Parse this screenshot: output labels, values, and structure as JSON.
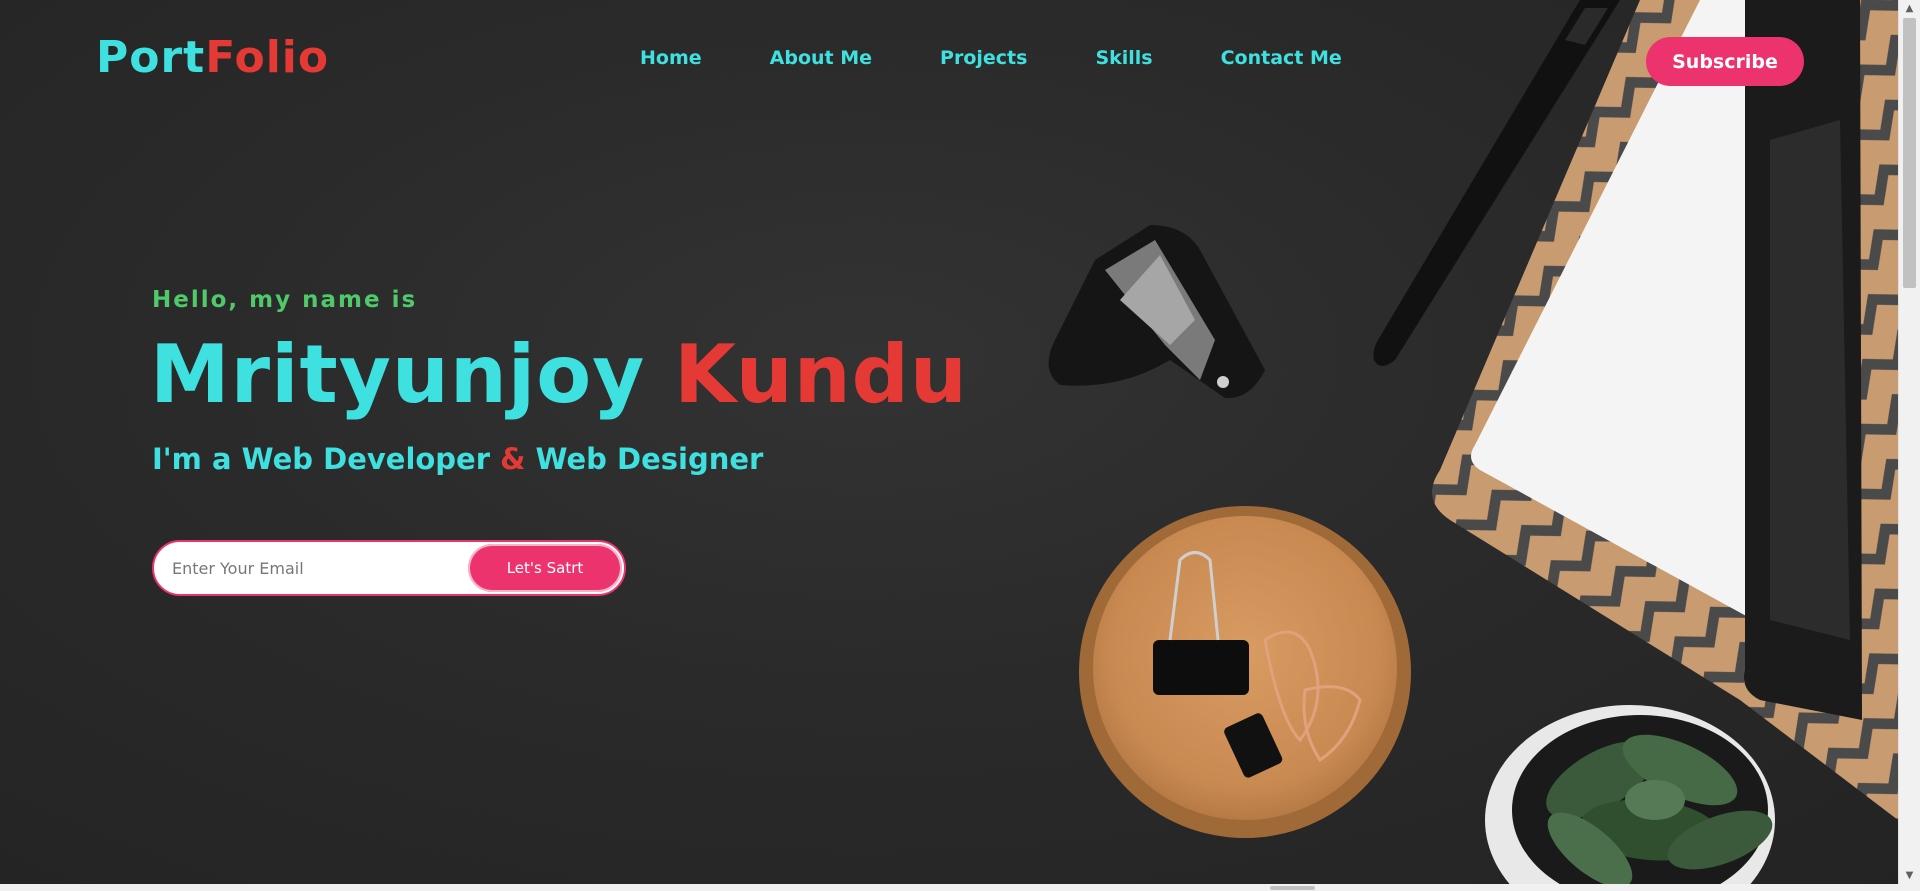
{
  "header": {
    "logo_part1": "Port",
    "logo_part2": "Folio",
    "nav": [
      "Home",
      "About Me",
      "Projects",
      "Skills",
      "Contact Me"
    ],
    "subscribe_label": "Subscribe"
  },
  "hero": {
    "greeting": "Hello, my name is",
    "first_name": "Mrityunjoy",
    "last_name": "Kundu",
    "role_prefix": "I'm a Web Developer",
    "role_amp": "&",
    "role_suffix": "Web Designer",
    "email_placeholder": "Enter Your Email",
    "cta_label": "Let's Satrt"
  },
  "colors": {
    "accent_cyan": "#3ee0e0",
    "accent_red": "#e53935",
    "accent_pink": "#ec336e",
    "greeting_green": "#4fc96a",
    "background": "#2a2a2a"
  },
  "icons": {
    "scroll_up": "triangle-up-icon",
    "scroll_down": "triangle-down-icon"
  }
}
